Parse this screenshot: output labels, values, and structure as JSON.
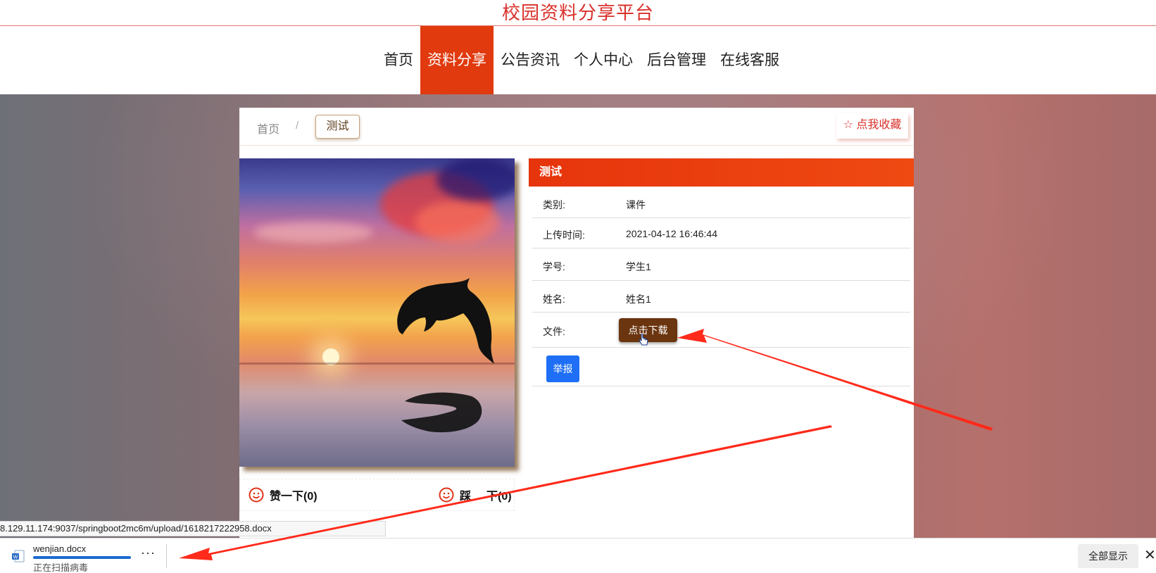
{
  "site": {
    "title": "校园资料分享平台"
  },
  "nav": {
    "items": [
      {
        "label": "首页",
        "active": false
      },
      {
        "label": "资料分享",
        "active": true
      },
      {
        "label": "公告资讯",
        "active": false
      },
      {
        "label": "个人中心",
        "active": false
      },
      {
        "label": "后台管理",
        "active": false
      },
      {
        "label": "在线客服",
        "active": false
      }
    ]
  },
  "breadcrumb": {
    "home": "首页",
    "separator": "/",
    "current": "测试"
  },
  "favorite": {
    "label": "☆ 点我收藏"
  },
  "detail": {
    "title": "测试",
    "rows": [
      {
        "label": "类别:",
        "value": "课件"
      },
      {
        "label": "上传时间:",
        "value": "2021-04-12 16:46:44"
      },
      {
        "label": "学号:",
        "value": "学生1"
      },
      {
        "label": "姓名:",
        "value": "姓名1"
      }
    ],
    "file_label": "文件:",
    "download_label": "点击下载",
    "report_label": "举报"
  },
  "votes": {
    "like": "赞一下(0)",
    "dislike_left": "踩",
    "dislike_right": "下(0)"
  },
  "status_bar": {
    "url": "8.129.11.174:9037/springboot2mc6m/upload/1618217222958.docx"
  },
  "download_bar": {
    "file_name": "wenjian.docx",
    "status": "正在扫描病毒",
    "progress": 1.0,
    "more_label": "···",
    "show_all_label": "全部显示",
    "close_label": "✕"
  },
  "colors": {
    "accent": "#e13a0e",
    "title_red": "#d9302a",
    "download_brown": "#6b3510",
    "report_blue": "#1e6ff5",
    "annotation_red": "#ff2a1a"
  }
}
